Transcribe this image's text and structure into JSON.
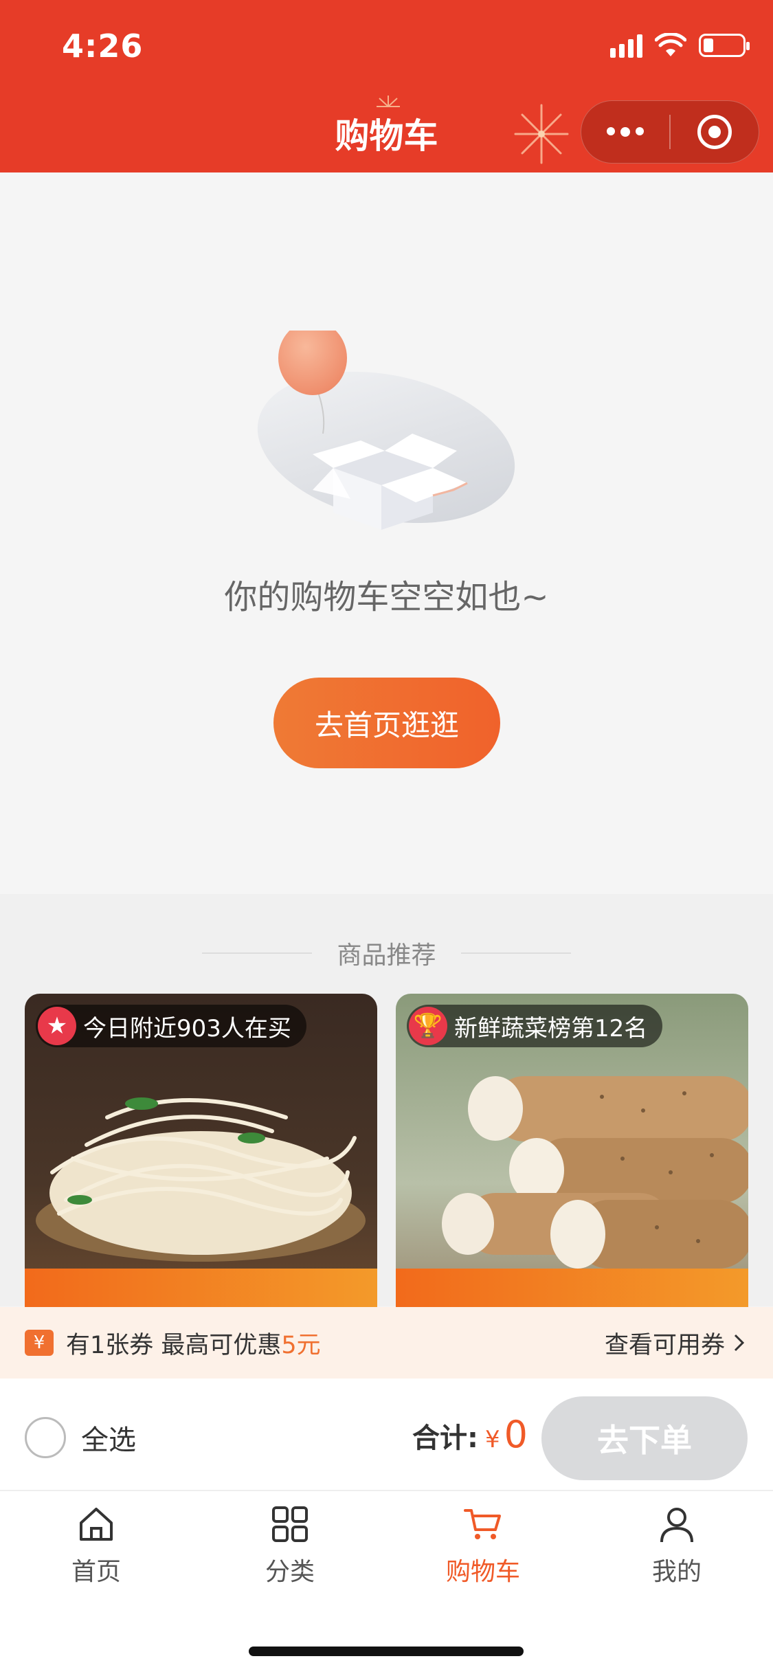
{
  "status_bar": {
    "time": "4:26"
  },
  "header": {
    "title": "购物车"
  },
  "empty_state": {
    "message": "你的购物车空空如也~",
    "button_label": "去首页逛逛"
  },
  "recommendations": {
    "title": "商品推荐",
    "items": [
      {
        "badge": "今日附近903人在买",
        "badge_icon": "star-icon"
      },
      {
        "badge": "新鲜蔬菜榜第12名",
        "badge_icon": "trophy-icon"
      }
    ]
  },
  "coupon_bar": {
    "icon_text": "¥",
    "text_prefix": "有1张券  最高可优惠",
    "amount": "5元",
    "link_label": "查看可用券"
  },
  "checkout": {
    "select_all_label": "全选",
    "total_label": "合计:",
    "currency": "¥",
    "total_value": "0",
    "order_button": "去下单"
  },
  "tabs": [
    {
      "label": "首页",
      "icon": "home-icon"
    },
    {
      "label": "分类",
      "icon": "category-icon"
    },
    {
      "label": "购物车",
      "icon": "cart-icon",
      "active": true
    },
    {
      "label": "我的",
      "icon": "user-icon"
    }
  ],
  "colors": {
    "header_bg": "#e63c28",
    "accent": "#f05a28",
    "disabled_button": "#d9dadc"
  }
}
